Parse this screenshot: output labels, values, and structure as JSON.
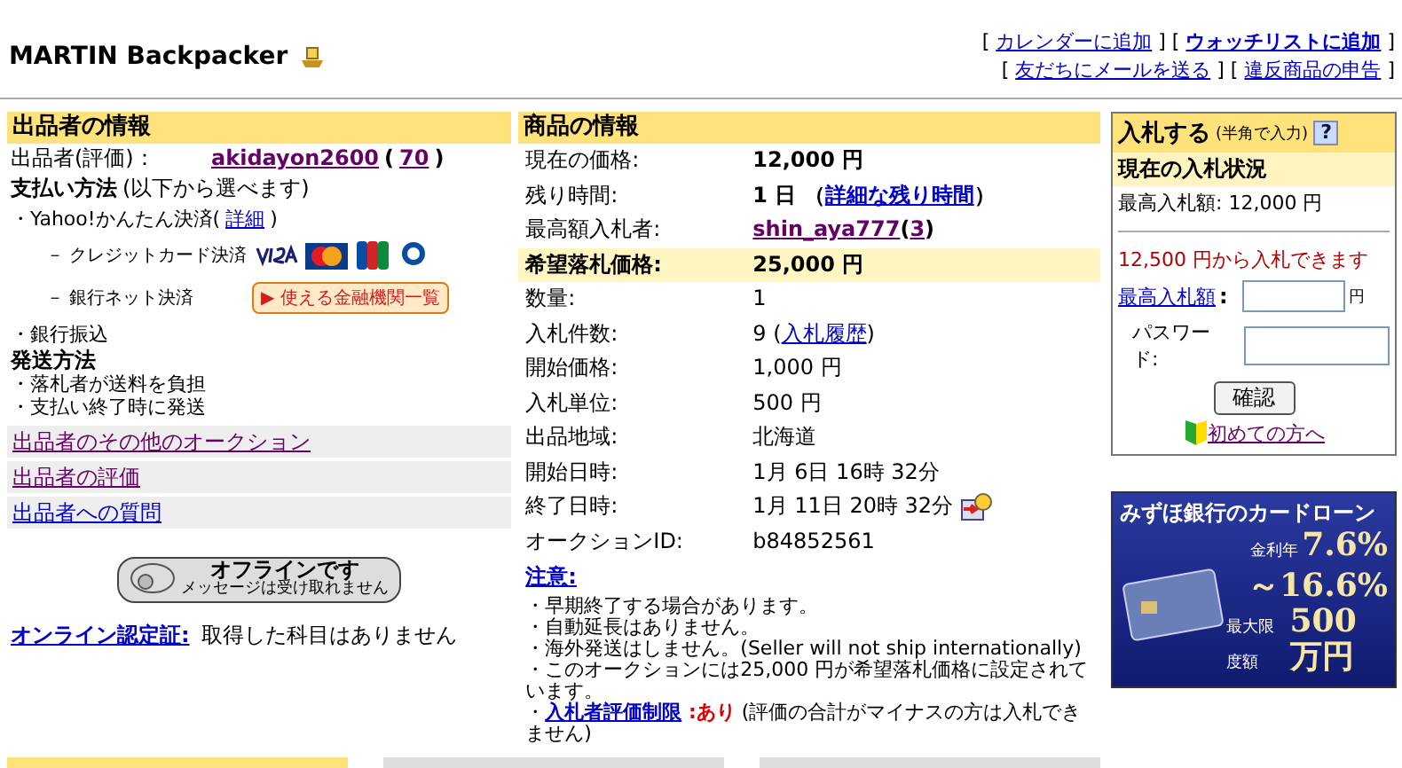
{
  "header": {
    "title": "MARTIN Backpacker",
    "link_rows": [
      [
        {
          "pre": "[ ",
          "label": "カレンダーに追加",
          "post": " ]",
          "bold": false
        },
        {
          "pre": " [ ",
          "label": "ウォッチリストに追加",
          "post": " ]",
          "bold": true
        }
      ],
      [
        {
          "pre": "[ ",
          "label": "友だちにメールを送る",
          "post": " ]",
          "bold": false
        },
        {
          "pre": " [ ",
          "label": "違反商品の申告",
          "post": " ]",
          "bold": false
        }
      ]
    ]
  },
  "seller": {
    "heading": "出品者の情報",
    "seller_label": "出品者(評価)：",
    "seller_name": "akidayon2600",
    "rating_open": "(",
    "rating": "70",
    "rating_close": ")",
    "payment_title": "支払い方法",
    "payment_note": "(以下から選べます)",
    "yahoo_pre": "・Yahoo!かんたん決済(",
    "yahoo_link": "詳細",
    "yahoo_post": ")",
    "credit": "－ クレジットカード決済",
    "bank_net": "－ 銀行ネット決済",
    "bank_button": "▶ 使える金融機関一覧",
    "bank_transfer": "・銀行振込",
    "shipping_title": "発送方法",
    "shipping_lines": [
      "・落札者が送料を負担",
      "・支払い終了時に発送"
    ],
    "links": [
      {
        "label": "出品者のその他のオークション",
        "visited": true
      },
      {
        "label": "出品者の評価",
        "visited": true
      },
      {
        "label": "出品者への質問",
        "visited": false
      }
    ],
    "offline": {
      "title": "オフラインです",
      "note": "メッセージは受け取れません"
    },
    "cert_link": "オンライン認定証:",
    "cert_text": "取得した科目はありません"
  },
  "item": {
    "heading": "商品の情報",
    "rows": [
      {
        "label": "現在の価格:",
        "highlight": false,
        "bold": true,
        "parts": [
          {
            "kind": "text",
            "text": "12,000 円"
          }
        ]
      },
      {
        "label": "残り時間:",
        "highlight": false,
        "bold": true,
        "parts": [
          {
            "kind": "text",
            "text": "1 日 （"
          },
          {
            "kind": "link",
            "text": "詳細な残り時間"
          },
          {
            "kind": "text",
            "text": "）"
          }
        ]
      },
      {
        "label": "最高額入札者:",
        "highlight": false,
        "bold": true,
        "parts": [
          {
            "kind": "visited",
            "text": "shin_aya777"
          },
          {
            "kind": "text",
            "text": " ("
          },
          {
            "kind": "visited",
            "text": "3"
          },
          {
            "kind": "text",
            "text": ")"
          }
        ]
      },
      {
        "label": "希望落札価格:",
        "highlight": true,
        "bold": true,
        "parts": [
          {
            "kind": "text",
            "text": "25,000 円"
          }
        ]
      },
      {
        "label": "数量:",
        "highlight": false,
        "bold": false,
        "parts": [
          {
            "kind": "text",
            "text": "1"
          }
        ]
      },
      {
        "label": "入札件数:",
        "highlight": false,
        "bold": false,
        "parts": [
          {
            "kind": "text",
            "text": "9 ("
          },
          {
            "kind": "link",
            "text": "入札履歴"
          },
          {
            "kind": "text",
            "text": ")"
          }
        ]
      },
      {
        "label": "開始価格:",
        "highlight": false,
        "bold": false,
        "parts": [
          {
            "kind": "text",
            "text": "1,000 円"
          }
        ]
      },
      {
        "label": "入札単位:",
        "highlight": false,
        "bold": false,
        "parts": [
          {
            "kind": "text",
            "text": "500 円"
          }
        ]
      },
      {
        "label": "出品地域:",
        "highlight": false,
        "bold": false,
        "parts": [
          {
            "kind": "text",
            "text": "北海道"
          }
        ]
      },
      {
        "label": "開始日時:",
        "highlight": false,
        "bold": false,
        "parts": [
          {
            "kind": "text",
            "text": "1月 6日 16時 32分"
          }
        ]
      },
      {
        "label": "終了日時:",
        "highlight": false,
        "bold": false,
        "parts": [
          {
            "kind": "text",
            "text": "1月 11日 20時 32分"
          },
          {
            "kind": "icon"
          }
        ]
      },
      {
        "label": "オークションID:",
        "highlight": false,
        "bold": false,
        "parts": [
          {
            "kind": "text",
            "text": "b84852561"
          }
        ]
      }
    ],
    "notes_heading": "注意:",
    "notes": [
      {
        "parts": [
          {
            "kind": "text",
            "text": "・早期終了する場合があります。"
          }
        ]
      },
      {
        "parts": [
          {
            "kind": "text",
            "text": "・自動延長はありません。"
          }
        ]
      },
      {
        "parts": [
          {
            "kind": "text",
            "text": "・海外発送はしません。(Seller will not ship internationally)"
          }
        ]
      },
      {
        "parts": [
          {
            "kind": "text",
            "text": "・このオークションには25,000 円が希望落札価格に設定されています。"
          }
        ]
      },
      {
        "parts": [
          {
            "kind": "text",
            "text": "・"
          },
          {
            "kind": "link",
            "text": "入札者評価制限"
          },
          {
            "kind": "alert",
            "text": " :あり"
          },
          {
            "kind": "text",
            "text": " (評価の合計がマイナスの方は入札できません)"
          }
        ]
      }
    ]
  },
  "bid": {
    "title": "入札する",
    "title_note": "(半角で入力)",
    "help": "?",
    "status_heading": "現在の入札状況",
    "high_bid": "最高入札額: 12,000 円",
    "min_bid": "12,500 円から入札できます",
    "max_label": "最高入札額",
    "max_colon": ":",
    "unit": "円",
    "password_label": "パスワード:",
    "confirm": "確認",
    "beginner_link": "初めての方へ"
  },
  "ad": {
    "headline": "みずほ銀行のカードローン",
    "rate_label": "金利年",
    "rate_low": "7.6%",
    "rate_high": "～16.6%",
    "limit_label": "最大限度額",
    "limit": "500万円"
  },
  "bottom_tabs": [
    {
      "selected": true
    },
    {
      "selected": false
    },
    {
      "selected": false
    }
  ]
}
